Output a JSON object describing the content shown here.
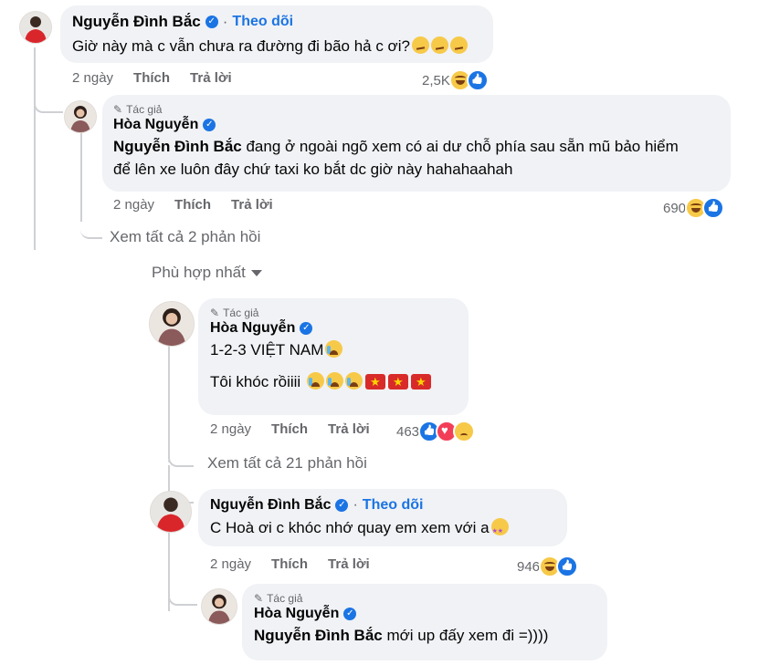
{
  "comment1": {
    "name": "Nguyễn Đình Bắc",
    "follow": "Theo dõi",
    "text": "Giờ này mà c vẫn chưa ra đường đi bão hả c ơi?",
    "time": "2 ngày",
    "like": "Thích",
    "reply": "Trả lời",
    "count": "2,5K"
  },
  "reply1": {
    "author_tag": "Tác giả",
    "name": "Hòa Nguyễn",
    "mention": "Nguyễn Đình Bắc",
    "text_line1": " đang ở ngoài ngõ xem có ai dư chỗ phía sau sẵn mũ bảo hiểm",
    "text_line2": "để lên xe luôn đây chứ taxi ko bắt dc giờ này hahahaahah",
    "time": "2 ngày",
    "like": "Thích",
    "reply": "Trả lời",
    "count": "690"
  },
  "view_replies_1": "Xem tất cả 2 phản hồi",
  "sort_label": "Phù hợp nhất",
  "comment2": {
    "author_tag": "Tác giả",
    "name": "Hòa Nguyễn",
    "line1": "1-2-3 VIỆT NAM",
    "line2": "Tôi khóc rồiiii",
    "time": "2 ngày",
    "like": "Thích",
    "reply": "Trả lời",
    "count": "463"
  },
  "view_replies_2": "Xem tất cả 21 phản hồi",
  "reply2": {
    "name": "Nguyễn Đình Bắc",
    "follow": "Theo dõi",
    "text": "C Hoà ơi c khóc nhớ quay em xem với a",
    "time": "2 ngày",
    "like": "Thích",
    "reply": "Trả lời",
    "count": "946"
  },
  "reply3": {
    "author_tag": "Tác giả",
    "name": "Hòa Nguyễn",
    "mention": "Nguyễn Đình Bắc",
    "text": " mới up đấy xem đi =))))"
  },
  "colors": {
    "accent": "#1b74e4",
    "bubble": "#f0f2f5",
    "muted": "#65676b"
  }
}
